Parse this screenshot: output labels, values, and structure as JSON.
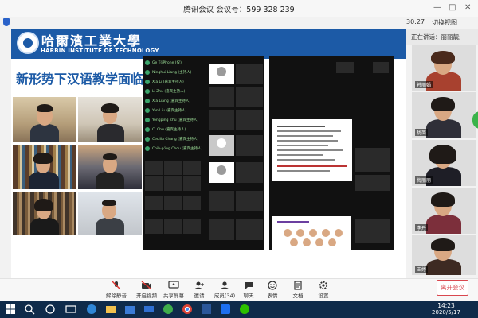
{
  "window": {
    "title": "腾讯会议 会议号：599 328 239",
    "controls": {
      "minimize": "—",
      "maximize": "□",
      "close": "✕"
    }
  },
  "sharebar": {
    "timer": "30:27",
    "switch_view": "切换视图"
  },
  "slide": {
    "university_cn": "哈爾濱工業大學",
    "university_en": "HARBIN INSTITUTE OF TECHNOLOGY",
    "title": "新形势下汉语教学面临的挑战与我们的对策",
    "participants_list": [
      "Ge T(iPhone (仅)",
      "Ninghui Liang (主持人)",
      "Xia Li (嘉宾主持人)",
      "Li Zhu (嘉宾主持人)",
      "Xia Liang (嘉宾主持人)",
      "Yan Liu (嘉宾主持人)",
      "Yongping Zhu (嘉宾主持人)",
      "C. Chu (嘉宾主持人)",
      "Cecilia Chang (嘉宾主持人)",
      "Chih-p'ing Chou (嘉宾主持人)"
    ]
  },
  "gallery": {
    "speaking": "正在讲话：丽丽靓;",
    "participants": [
      {
        "name": "韩丽娟"
      },
      {
        "name": "杨芮"
      },
      {
        "name": "梅丽丽"
      },
      {
        "name": "李丹"
      },
      {
        "name": "王婷"
      }
    ]
  },
  "toolbar": {
    "items": [
      {
        "label": "解除静音",
        "icon": "mic-muted-icon"
      },
      {
        "label": "开启视频",
        "icon": "camera-off-icon"
      },
      {
        "label": "共享屏幕",
        "icon": "screen-share-icon"
      },
      {
        "label": "邀请",
        "icon": "invite-icon"
      },
      {
        "label": "成员(34)",
        "icon": "members-icon"
      },
      {
        "label": "聊天",
        "icon": "chat-icon"
      },
      {
        "label": "表情",
        "icon": "emoji-icon"
      },
      {
        "label": "文档",
        "icon": "document-icon"
      },
      {
        "label": "设置",
        "icon": "settings-icon"
      }
    ],
    "leave": "离开会议"
  },
  "taskbar": {
    "time": "14:23",
    "date": "2020/5/17"
  }
}
